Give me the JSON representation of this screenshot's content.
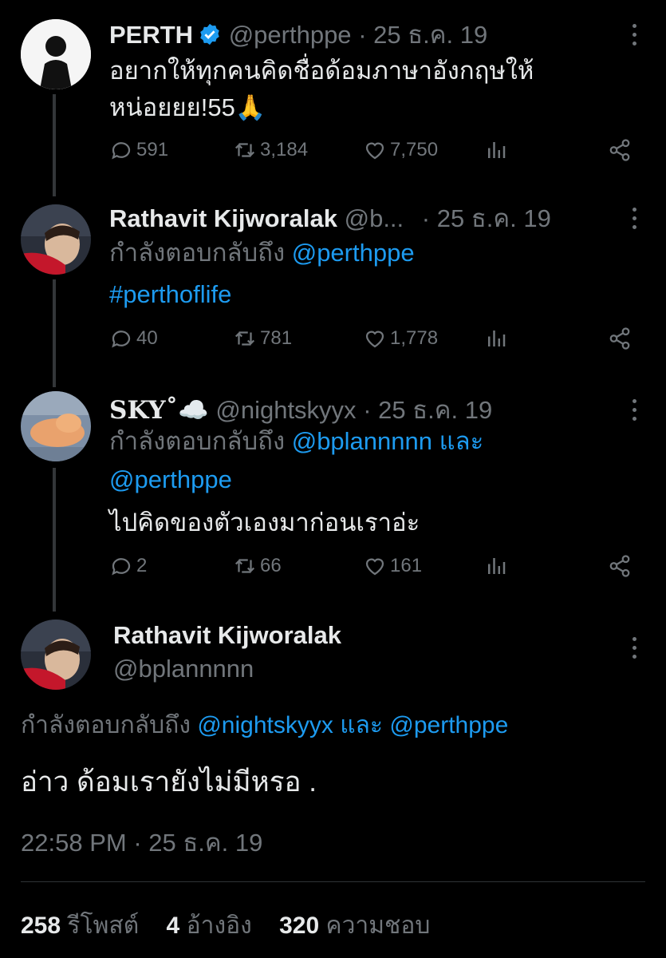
{
  "colors": {
    "background": "#000000",
    "text": "#e7e9ea",
    "muted": "#71767b",
    "link": "#1d9bf0",
    "verified": "#1d9bf0"
  },
  "tweets": [
    {
      "name": "PERTH",
      "handle": "@perthppe",
      "sep": "·",
      "date": "25 ธ.ค. 19",
      "verified": true,
      "text_lines": [
        "อยากให้ทุกคนคิดชื่อด้อมภาษาอังกฤษให้",
        "หน่อยยย!55🙏"
      ],
      "replies": "591",
      "retweets": "3,184",
      "likes": "7,750"
    },
    {
      "name": "Rathavit Kijworalak",
      "handle": "@b...",
      "sep": "·",
      "date": "25 ธ.ค. 19",
      "replying_to": "กำลังตอบกลับถึง",
      "mention1": "@perthppe",
      "text": "#perthoflife",
      "replies": "40",
      "retweets": "781",
      "likes": "1,778"
    },
    {
      "name": "SKY˚☁️",
      "handle": "@nightskyyx",
      "sep": "·",
      "date": "25 ธ.ค. 19",
      "replying_to": "กำลังตอบกลับถึง",
      "mention1": "@bplannnnn",
      "and": "และ",
      "mention2": "@perthppe",
      "text": "ไปคิดของตัวเองมาก่อนเราอ่ะ",
      "replies": "2",
      "retweets": "66",
      "likes": "161"
    }
  ],
  "main_tweet": {
    "name": "Rathavit Kijworalak",
    "handle": "@bplannnnn",
    "replying_to": "กำลังตอบกลับถึง",
    "mention1": "@nightskyyx",
    "and": "และ",
    "mention2": "@perthppe",
    "text": "อ่าว ด้อมเรายังไม่มีหรอ .",
    "time": "22:58 PM",
    "sep": "·",
    "date": "25 ธ.ค. 19",
    "reposts_count": "258",
    "reposts_label": "รีโพสต์",
    "quotes_count": "4",
    "quotes_label": "อ้างอิง",
    "likes_count": "320",
    "likes_label": "ความชอบ"
  }
}
